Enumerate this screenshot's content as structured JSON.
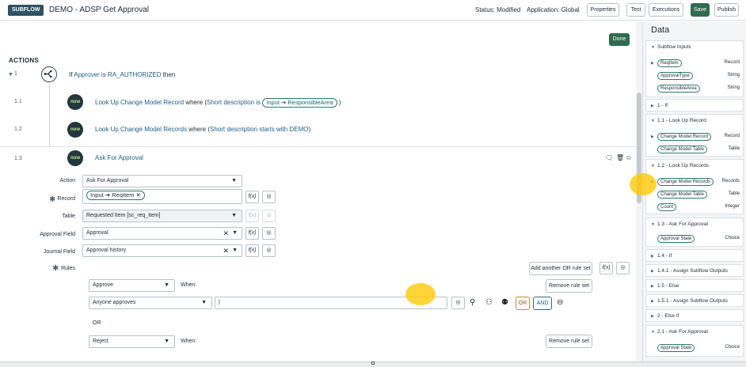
{
  "header": {
    "badge": "SUBFLOW",
    "title": "DEMO - ADSP Get Approval",
    "status": "Status: Modified",
    "application": "Application: Global",
    "buttons": {
      "properties": "Properties",
      "test": "Test",
      "executions": "Executions",
      "save": "Save",
      "publish": "Publish"
    }
  },
  "main": {
    "done_label": "Done",
    "actions_label": "ACTIONS",
    "steps": [
      {
        "num": "1",
        "pre": "If ",
        "cond": "Approver is RA_AUTHORIZED",
        "post": " then"
      },
      {
        "num": "1.1",
        "name": "Look Up Change Model Record",
        "mid": " where (",
        "cond": "Short description is",
        "pill": "Input ➔ ResponsibleArea",
        "end": ")"
      },
      {
        "num": "1.2",
        "name": "Look Up Change Model Records",
        "mid": " where (",
        "cond": "Short description starts with DEMO",
        "end": ")"
      },
      {
        "num": "1.3",
        "name": "Ask For Approval"
      }
    ],
    "now_label": "now",
    "form": {
      "action_label": "Action",
      "action_value": "Ask For Approval",
      "record_label": "Record",
      "record_pill": "Input ➔ ReqItem",
      "table_label": "Table",
      "table_value": "Requested Item [sc_req_item]",
      "approval_field_label": "Approval Field",
      "approval_field_value": "Approval",
      "journal_field_label": "Journal Field",
      "journal_field_value": "Approval history",
      "rules_label": "Rules",
      "fx_label": "f(x)",
      "add_rule_set": "Add another OR rule set",
      "rule1_action": "Approve",
      "when_label": "When:",
      "remove_rule_set": "Remove rule set",
      "rule1_condition": "Anyone approves",
      "rule1_input_value": "|",
      "or_button": "OR",
      "and_button": "AND",
      "or_label": "OR",
      "rule2_action": "Reject"
    }
  },
  "panel": {
    "title": "Data",
    "sections": [
      {
        "title": "Subflow Inputs",
        "items": [
          {
            "name": "ReqItem",
            "type": "Record"
          },
          {
            "name": "ApprovalType",
            "type": "String"
          },
          {
            "name": "ResponsibleArea",
            "type": "String"
          }
        ]
      },
      {
        "title": "1 - If",
        "items": []
      },
      {
        "title": "1.1 - Look Up Record",
        "items": [
          {
            "name": "Change Model Record",
            "type": "Record"
          },
          {
            "name": "Change Model Table",
            "type": "Table"
          }
        ]
      },
      {
        "title": "1.2 - Look Up Records",
        "items": [
          {
            "name": "Change Model Records",
            "type": "Records"
          },
          {
            "name": "Change Model Table",
            "type": "Table"
          },
          {
            "name": "Count",
            "type": "Integer"
          }
        ]
      },
      {
        "title": "1.3 - Ask For Approval",
        "items": [
          {
            "name": "Approval State",
            "type": "Choice"
          }
        ]
      },
      {
        "title": "1.4 - If",
        "items": []
      },
      {
        "title": "1.4.1 - Assign Subflow Outputs",
        "items": []
      },
      {
        "title": "1.5 - Else",
        "items": []
      },
      {
        "title": "1.5.1 - Assign Subflow Outputs",
        "items": []
      },
      {
        "title": "2 - Else If",
        "items": []
      },
      {
        "title": "2.1 - Ask For Approval",
        "items": [
          {
            "name": "Approval State",
            "type": "Choice"
          }
        ]
      }
    ]
  },
  "colors": {
    "accent_green": "#2e6b4f",
    "link_blue": "#1f5c86",
    "highlight_yellow": "#ffc800"
  }
}
